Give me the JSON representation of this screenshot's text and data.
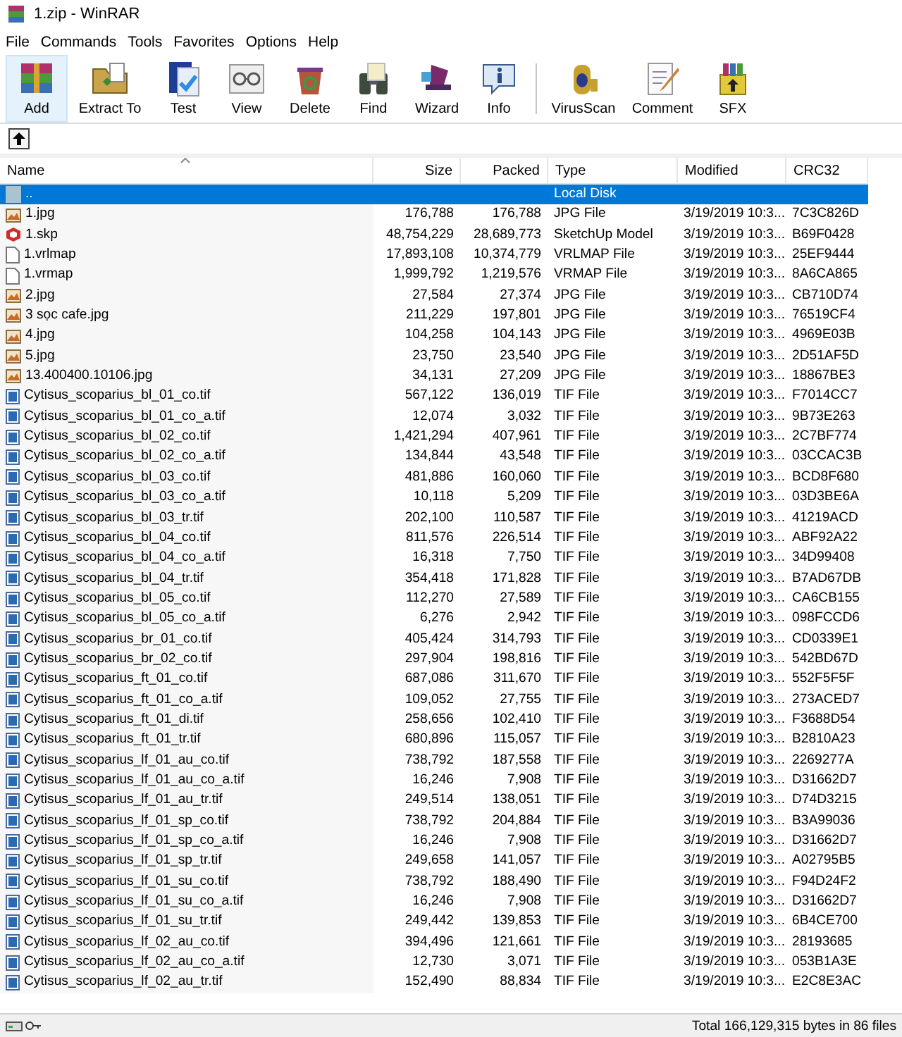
{
  "window": {
    "title": "1.zip - WinRAR"
  },
  "menu": [
    "File",
    "Commands",
    "Tools",
    "Favorites",
    "Options",
    "Help"
  ],
  "toolbar": [
    {
      "label": "Add",
      "selected": true
    },
    {
      "label": "Extract To",
      "selected": false
    },
    {
      "label": "Test",
      "selected": false
    },
    {
      "label": "View",
      "selected": false
    },
    {
      "label": "Delete",
      "selected": false
    },
    {
      "label": "Find",
      "selected": false
    },
    {
      "label": "Wizard",
      "selected": false
    },
    {
      "label": "Info",
      "selected": false
    },
    {
      "label": "VirusScan",
      "selected": false
    },
    {
      "label": "Comment",
      "selected": false
    },
    {
      "label": "SFX",
      "selected": false
    }
  ],
  "table": {
    "columns": [
      "Name",
      "Size",
      "Packed",
      "Type",
      "Modified",
      "CRC32"
    ],
    "rows": [
      {
        "kind": "parent",
        "name": "..",
        "size": "",
        "packed": "",
        "type": "Local Disk",
        "modified": "",
        "crc32": "",
        "selected": true
      },
      {
        "kind": "image",
        "name": "1.jpg",
        "size": "176,788",
        "packed": "176,788",
        "type": "JPG File",
        "modified": "3/19/2019 10:3...",
        "crc32": "7C3C826D",
        "selected": false
      },
      {
        "kind": "sketchup",
        "name": "1.skp",
        "size": "48,754,229",
        "packed": "28,689,773",
        "type": "SketchUp Model",
        "modified": "3/19/2019 10:3...",
        "crc32": "B69F0428",
        "selected": false
      },
      {
        "kind": "file",
        "name": "1.vrlmap",
        "size": "17,893,108",
        "packed": "10,374,779",
        "type": "VRLMAP File",
        "modified": "3/19/2019 10:3...",
        "crc32": "25EF9444",
        "selected": false
      },
      {
        "kind": "file",
        "name": "1.vrmap",
        "size": "1,999,792",
        "packed": "1,219,576",
        "type": "VRMAP File",
        "modified": "3/19/2019 10:3...",
        "crc32": "8A6CA865",
        "selected": false
      },
      {
        "kind": "image",
        "name": "2.jpg",
        "size": "27,584",
        "packed": "27,374",
        "type": "JPG File",
        "modified": "3/19/2019 10:3...",
        "crc32": "CB710D74",
        "selected": false
      },
      {
        "kind": "image",
        "name": "3 sọc cafe.jpg",
        "size": "211,229",
        "packed": "197,801",
        "type": "JPG File",
        "modified": "3/19/2019 10:3...",
        "crc32": "76519CF4",
        "selected": false
      },
      {
        "kind": "image",
        "name": "4.jpg",
        "size": "104,258",
        "packed": "104,143",
        "type": "JPG File",
        "modified": "3/19/2019 10:3...",
        "crc32": "4969E03B",
        "selected": false
      },
      {
        "kind": "image",
        "name": "5.jpg",
        "size": "23,750",
        "packed": "23,540",
        "type": "JPG File",
        "modified": "3/19/2019 10:3...",
        "crc32": "2D51AF5D",
        "selected": false
      },
      {
        "kind": "image",
        "name": "13.400400.10106.jpg",
        "size": "34,131",
        "packed": "27,209",
        "type": "JPG File",
        "modified": "3/19/2019 10:3...",
        "crc32": "18867BE3",
        "selected": false
      },
      {
        "kind": "tif",
        "name": "Cytisus_scoparius_bl_01_co.tif",
        "size": "567,122",
        "packed": "136,019",
        "type": "TIF File",
        "modified": "3/19/2019 10:3...",
        "crc32": "F7014CC7",
        "selected": false
      },
      {
        "kind": "tif",
        "name": "Cytisus_scoparius_bl_01_co_a.tif",
        "size": "12,074",
        "packed": "3,032",
        "type": "TIF File",
        "modified": "3/19/2019 10:3...",
        "crc32": "9B73E263",
        "selected": false
      },
      {
        "kind": "tif",
        "name": "Cytisus_scoparius_bl_02_co.tif",
        "size": "1,421,294",
        "packed": "407,961",
        "type": "TIF File",
        "modified": "3/19/2019 10:3...",
        "crc32": "2C7BF774",
        "selected": false
      },
      {
        "kind": "tif",
        "name": "Cytisus_scoparius_bl_02_co_a.tif",
        "size": "134,844",
        "packed": "43,548",
        "type": "TIF File",
        "modified": "3/19/2019 10:3...",
        "crc32": "03CCAC3B",
        "selected": false
      },
      {
        "kind": "tif",
        "name": "Cytisus_scoparius_bl_03_co.tif",
        "size": "481,886",
        "packed": "160,060",
        "type": "TIF File",
        "modified": "3/19/2019 10:3...",
        "crc32": "BCD8F680",
        "selected": false
      },
      {
        "kind": "tif",
        "name": "Cytisus_scoparius_bl_03_co_a.tif",
        "size": "10,118",
        "packed": "5,209",
        "type": "TIF File",
        "modified": "3/19/2019 10:3...",
        "crc32": "03D3BE6A",
        "selected": false
      },
      {
        "kind": "tif",
        "name": "Cytisus_scoparius_bl_03_tr.tif",
        "size": "202,100",
        "packed": "110,587",
        "type": "TIF File",
        "modified": "3/19/2019 10:3...",
        "crc32": "41219ACD",
        "selected": false
      },
      {
        "kind": "tif",
        "name": "Cytisus_scoparius_bl_04_co.tif",
        "size": "811,576",
        "packed": "226,514",
        "type": "TIF File",
        "modified": "3/19/2019 10:3...",
        "crc32": "ABF92A22",
        "selected": false
      },
      {
        "kind": "tif",
        "name": "Cytisus_scoparius_bl_04_co_a.tif",
        "size": "16,318",
        "packed": "7,750",
        "type": "TIF File",
        "modified": "3/19/2019 10:3...",
        "crc32": "34D99408",
        "selected": false
      },
      {
        "kind": "tif",
        "name": "Cytisus_scoparius_bl_04_tr.tif",
        "size": "354,418",
        "packed": "171,828",
        "type": "TIF File",
        "modified": "3/19/2019 10:3...",
        "crc32": "B7AD67DB",
        "selected": false
      },
      {
        "kind": "tif",
        "name": "Cytisus_scoparius_bl_05_co.tif",
        "size": "112,270",
        "packed": "27,589",
        "type": "TIF File",
        "modified": "3/19/2019 10:3...",
        "crc32": "CA6CB155",
        "selected": false
      },
      {
        "kind": "tif",
        "name": "Cytisus_scoparius_bl_05_co_a.tif",
        "size": "6,276",
        "packed": "2,942",
        "type": "TIF File",
        "modified": "3/19/2019 10:3...",
        "crc32": "098FCCD6",
        "selected": false
      },
      {
        "kind": "tif",
        "name": "Cytisus_scoparius_br_01_co.tif",
        "size": "405,424",
        "packed": "314,793",
        "type": "TIF File",
        "modified": "3/19/2019 10:3...",
        "crc32": "CD0339E1",
        "selected": false
      },
      {
        "kind": "tif",
        "name": "Cytisus_scoparius_br_02_co.tif",
        "size": "297,904",
        "packed": "198,816",
        "type": "TIF File",
        "modified": "3/19/2019 10:3...",
        "crc32": "542BD67D",
        "selected": false
      },
      {
        "kind": "tif",
        "name": "Cytisus_scoparius_ft_01_co.tif",
        "size": "687,086",
        "packed": "311,670",
        "type": "TIF File",
        "modified": "3/19/2019 10:3...",
        "crc32": "552F5F5F",
        "selected": false
      },
      {
        "kind": "tif",
        "name": "Cytisus_scoparius_ft_01_co_a.tif",
        "size": "109,052",
        "packed": "27,755",
        "type": "TIF File",
        "modified": "3/19/2019 10:3...",
        "crc32": "273ACED7",
        "selected": false
      },
      {
        "kind": "tif",
        "name": "Cytisus_scoparius_ft_01_di.tif",
        "size": "258,656",
        "packed": "102,410",
        "type": "TIF File",
        "modified": "3/19/2019 10:3...",
        "crc32": "F3688D54",
        "selected": false
      },
      {
        "kind": "tif",
        "name": "Cytisus_scoparius_ft_01_tr.tif",
        "size": "680,896",
        "packed": "115,057",
        "type": "TIF File",
        "modified": "3/19/2019 10:3...",
        "crc32": "B2810A23",
        "selected": false
      },
      {
        "kind": "tif",
        "name": "Cytisus_scoparius_lf_01_au_co.tif",
        "size": "738,792",
        "packed": "187,558",
        "type": "TIF File",
        "modified": "3/19/2019 10:3...",
        "crc32": "2269277A",
        "selected": false
      },
      {
        "kind": "tif",
        "name": "Cytisus_scoparius_lf_01_au_co_a.tif",
        "size": "16,246",
        "packed": "7,908",
        "type": "TIF File",
        "modified": "3/19/2019 10:3...",
        "crc32": "D31662D7",
        "selected": false
      },
      {
        "kind": "tif",
        "name": "Cytisus_scoparius_lf_01_au_tr.tif",
        "size": "249,514",
        "packed": "138,051",
        "type": "TIF File",
        "modified": "3/19/2019 10:3...",
        "crc32": "D74D3215",
        "selected": false
      },
      {
        "kind": "tif",
        "name": "Cytisus_scoparius_lf_01_sp_co.tif",
        "size": "738,792",
        "packed": "204,884",
        "type": "TIF File",
        "modified": "3/19/2019 10:3...",
        "crc32": "B3A99036",
        "selected": false
      },
      {
        "kind": "tif",
        "name": "Cytisus_scoparius_lf_01_sp_co_a.tif",
        "size": "16,246",
        "packed": "7,908",
        "type": "TIF File",
        "modified": "3/19/2019 10:3...",
        "crc32": "D31662D7",
        "selected": false
      },
      {
        "kind": "tif",
        "name": "Cytisus_scoparius_lf_01_sp_tr.tif",
        "size": "249,658",
        "packed": "141,057",
        "type": "TIF File",
        "modified": "3/19/2019 10:3...",
        "crc32": "A02795B5",
        "selected": false
      },
      {
        "kind": "tif",
        "name": "Cytisus_scoparius_lf_01_su_co.tif",
        "size": "738,792",
        "packed": "188,490",
        "type": "TIF File",
        "modified": "3/19/2019 10:3...",
        "crc32": "F94D24F2",
        "selected": false
      },
      {
        "kind": "tif",
        "name": "Cytisus_scoparius_lf_01_su_co_a.tif",
        "size": "16,246",
        "packed": "7,908",
        "type": "TIF File",
        "modified": "3/19/2019 10:3...",
        "crc32": "D31662D7",
        "selected": false
      },
      {
        "kind": "tif",
        "name": "Cytisus_scoparius_lf_01_su_tr.tif",
        "size": "249,442",
        "packed": "139,853",
        "type": "TIF File",
        "modified": "3/19/2019 10:3...",
        "crc32": "6B4CE700",
        "selected": false
      },
      {
        "kind": "tif",
        "name": "Cytisus_scoparius_lf_02_au_co.tif",
        "size": "394,496",
        "packed": "121,661",
        "type": "TIF File",
        "modified": "3/19/2019 10:3...",
        "crc32": "28193685",
        "selected": false
      },
      {
        "kind": "tif",
        "name": "Cytisus_scoparius_lf_02_au_co_a.tif",
        "size": "12,730",
        "packed": "3,071",
        "type": "TIF File",
        "modified": "3/19/2019 10:3...",
        "crc32": "053B1A3E",
        "selected": false
      },
      {
        "kind": "tif",
        "name": "Cytisus_scoparius_lf_02_au_tr.tif",
        "size": "152,490",
        "packed": "88,834",
        "type": "TIF File",
        "modified": "3/19/2019 10:3...",
        "crc32": "E2C8E3AC",
        "selected": false
      }
    ]
  },
  "status_bar": {
    "total": "Total 166,129,315 bytes in 86 files"
  }
}
